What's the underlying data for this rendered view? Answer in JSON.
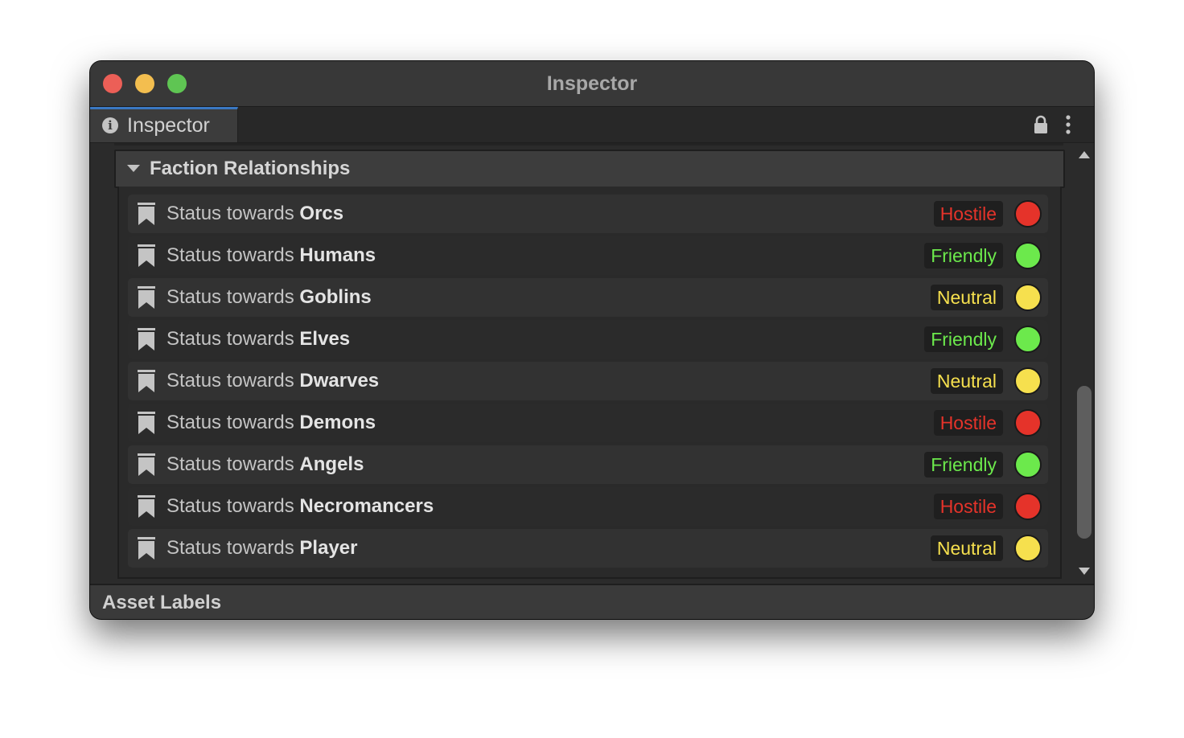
{
  "window": {
    "title": "Inspector"
  },
  "tab": {
    "label": "Inspector",
    "icon": "info-icon"
  },
  "toolbar": {
    "lock_icon": "lock-icon",
    "menu_icon": "kebab-menu-icon"
  },
  "foldout": {
    "title": "Faction Relationships",
    "expanded": true
  },
  "status_colors": {
    "Hostile": "#e5332a",
    "Friendly": "#6ce94c",
    "Neutral": "#f6e04e"
  },
  "relationships": [
    {
      "prefix": "Status towards ",
      "faction": "Orcs",
      "status": "Hostile"
    },
    {
      "prefix": "Status towards ",
      "faction": "Humans",
      "status": "Friendly"
    },
    {
      "prefix": "Status towards ",
      "faction": "Goblins",
      "status": "Neutral"
    },
    {
      "prefix": "Status towards ",
      "faction": "Elves",
      "status": "Friendly"
    },
    {
      "prefix": "Status towards ",
      "faction": "Dwarves",
      "status": "Neutral"
    },
    {
      "prefix": "Status towards ",
      "faction": "Demons",
      "status": "Hostile"
    },
    {
      "prefix": "Status towards ",
      "faction": "Angels",
      "status": "Friendly"
    },
    {
      "prefix": "Status towards ",
      "faction": "Necromancers",
      "status": "Hostile"
    },
    {
      "prefix": "Status towards ",
      "faction": "Player",
      "status": "Neutral"
    }
  ],
  "footer": {
    "title": "Asset Labels"
  }
}
